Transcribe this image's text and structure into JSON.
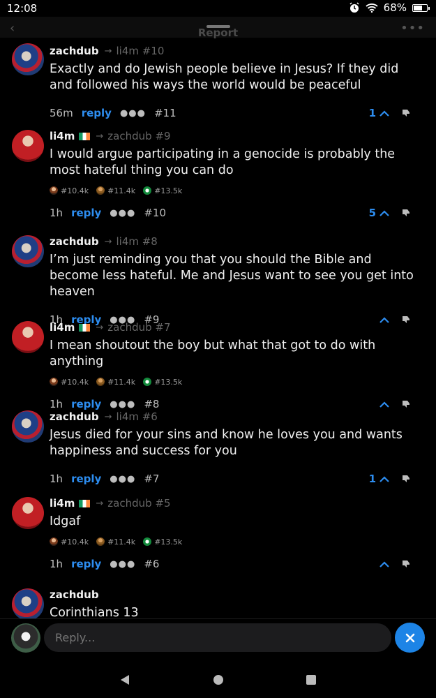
{
  "status_bar": {
    "time": "12:08",
    "battery": "68%",
    "battery_level": 0.68
  },
  "header": {
    "title": "Report"
  },
  "comments": [
    {
      "user": "zachdub",
      "reply_to": "li4m #10",
      "text": "Exactly and do Jewish people believe in Jesus? If they did and followed his ways the world would be peaceful",
      "time": "56m",
      "reply_label": "reply",
      "number": "#11",
      "votes": "1"
    },
    {
      "user": "li4m",
      "reply_to": "zachdub #9",
      "text": "I would argue participating in a genocide is probably the most hateful thing you can do",
      "badges": [
        "#10.4k",
        "#11.4k",
        "#13.5k"
      ],
      "time": "1h",
      "reply_label": "reply",
      "number": "#10",
      "votes": "5"
    },
    {
      "user": "zachdub",
      "reply_to": "li4m #8",
      "text": "I’m just reminding you that you should the Bible and become less hateful. Me and Jesus want to see you get into heaven",
      "time": "1h",
      "reply_label": "reply",
      "number": "#9",
      "votes": ""
    },
    {
      "user": "li4m",
      "reply_to": "zachdub #7",
      "text": "I mean shoutout the boy but what that got to do with anything",
      "badges": [
        "#10.4k",
        "#11.4k",
        "#13.5k"
      ],
      "time": "1h",
      "reply_label": "reply",
      "number": "#8",
      "votes": ""
    },
    {
      "user": "zachdub",
      "reply_to": "li4m #6",
      "text": "Jesus died for your sins and know he loves you and wants happiness and success for you",
      "time": "1h",
      "reply_label": "reply",
      "number": "#7",
      "votes": "1"
    },
    {
      "user": "li4m",
      "reply_to": "zachdub #5",
      "text": "Idgaf",
      "badges": [
        "#10.4k",
        "#11.4k",
        "#13.5k"
      ],
      "time": "1h",
      "reply_label": "reply",
      "number": "#6",
      "votes": ""
    },
    {
      "user": "zachdub",
      "text": "Corinthians 13"
    }
  ],
  "composer": {
    "placeholder": "Reply..."
  }
}
